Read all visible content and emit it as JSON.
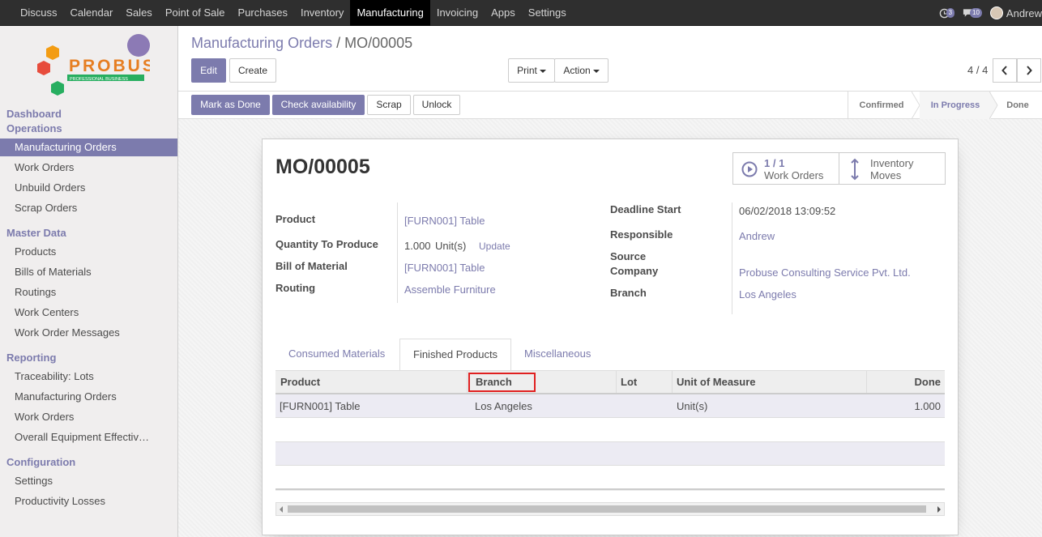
{
  "topbar": {
    "menu": [
      "Discuss",
      "Calendar",
      "Sales",
      "Point of Sale",
      "Purchases",
      "Inventory",
      "Manufacturing",
      "Invoicing",
      "Apps",
      "Settings"
    ],
    "active": "Manufacturing",
    "activity_count": "3",
    "message_count": "10",
    "user": "Andrew"
  },
  "sidebar": {
    "logo_text": "PROBUSE",
    "logo_sub": "PROFESSIONAL BUSINESS",
    "section_dashboard": "Dashboard",
    "section_operations": "Operations",
    "operations": [
      "Manufacturing Orders",
      "Work Orders",
      "Unbuild Orders",
      "Scrap Orders"
    ],
    "section_master": "Master Data",
    "master": [
      "Products",
      "Bills of Materials",
      "Routings",
      "Work Centers",
      "Work Order Messages"
    ],
    "section_reporting": "Reporting",
    "reporting": [
      "Traceability: Lots",
      "Manufacturing Orders",
      "Work Orders",
      "Overall Equipment Effectiv…"
    ],
    "section_config": "Configuration",
    "config": [
      "Settings",
      "Productivity Losses"
    ]
  },
  "control": {
    "breadcrumb_parent": "Manufacturing Orders",
    "breadcrumb_sep": "/",
    "breadcrumb_current": "MO/00005",
    "edit": "Edit",
    "create": "Create",
    "print": "Print",
    "action": "Action",
    "pager": "4 / 4"
  },
  "statusbar": {
    "mark_done": "Mark as Done",
    "check_availability": "Check availability",
    "scrap": "Scrap",
    "unlock": "Unlock",
    "stages": [
      "Confirmed",
      "In Progress",
      "Done"
    ],
    "current_stage": "In Progress"
  },
  "form": {
    "name": "MO/00005",
    "smart_work_orders_count": "1 / 1",
    "smart_work_orders_label": "Work Orders",
    "smart_inventory_l1": "Inventory",
    "smart_inventory_l2": "Moves",
    "product_label": "Product",
    "product_value": "[FURN001] Table",
    "qty_label": "Quantity To Produce",
    "qty_value": "1.000",
    "qty_uom": "Unit(s)",
    "qty_update": "Update",
    "bom_label": "Bill of Material",
    "bom_value": "[FURN001] Table",
    "routing_label": "Routing",
    "routing_value": "Assemble Furniture",
    "deadline_label": "Deadline Start",
    "deadline_value": "06/02/2018 13:09:52",
    "responsible_label": "Responsible",
    "responsible_value": "Andrew",
    "source_label": "Source",
    "company_label": "Company",
    "company_value": "Probuse Consulting Service Pvt. Ltd.",
    "branch_label": "Branch",
    "branch_value": "Los Angeles"
  },
  "tabs": [
    "Consumed Materials",
    "Finished Products",
    "Miscellaneous"
  ],
  "active_tab": "Finished Products",
  "table": {
    "columns": [
      "Product",
      "Branch",
      "Lot",
      "Unit of Measure",
      "Done"
    ],
    "rows": [
      {
        "product": "[FURN001] Table",
        "branch": "Los Angeles",
        "lot": "",
        "uom": "Unit(s)",
        "done": "1.000"
      }
    ]
  },
  "colors": {
    "accent": "#7c7bad",
    "topbar": "#2f2f2f",
    "highlight": "#e02020"
  }
}
